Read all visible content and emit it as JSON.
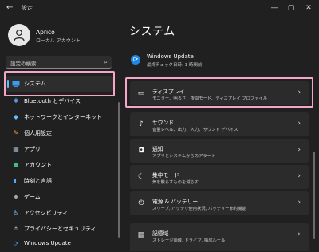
{
  "window": {
    "title": "設定",
    "back_icon": "arrow-left-icon",
    "minimize_glyph": "—",
    "maximize_glyph": "▢",
    "close_glyph": "✕"
  },
  "profile": {
    "name": "Aprico",
    "account_type": "ローカル アカウント"
  },
  "search": {
    "placeholder": "設定の検索"
  },
  "sidebar": {
    "items": [
      {
        "label": "システム",
        "icon": "monitor-icon",
        "active": true
      },
      {
        "label": "Bluetooth とデバイス",
        "icon": "bluetooth-icon"
      },
      {
        "label": "ネットワークとインターネット",
        "icon": "network-icon"
      },
      {
        "label": "個人用設定",
        "icon": "brush-icon"
      },
      {
        "label": "アプリ",
        "icon": "apps-icon"
      },
      {
        "label": "アカウント",
        "icon": "account-icon"
      },
      {
        "label": "時刻と言語",
        "icon": "globe-clock-icon"
      },
      {
        "label": "ゲーム",
        "icon": "gamepad-icon"
      },
      {
        "label": "アクセシビリティ",
        "icon": "accessibility-icon"
      },
      {
        "label": "プライバシーとセキュリティ",
        "icon": "shield-icon"
      },
      {
        "label": "Windows Update",
        "icon": "update-icon"
      }
    ]
  },
  "main": {
    "title": "システム",
    "windows_update": {
      "title": "Windows Update",
      "subtitle": "最終チェック日時: 1 時間前"
    },
    "cards": [
      {
        "title": "ディスプレイ",
        "subtitle": "モニター、明るさ、夜間モード、ディスプレイ プロファイル",
        "icon": "display-icon"
      },
      {
        "title": "サウンド",
        "subtitle": "音量レベル、出力、入力、サウンド デバイス",
        "icon": "speaker-icon"
      },
      {
        "title": "通知",
        "subtitle": "アプリとシステムからのアラート",
        "icon": "bell-icon"
      },
      {
        "title": "集中モード",
        "subtitle": "気を散らすものを減らす",
        "icon": "focus-icon"
      },
      {
        "title": "電源 & バッテリー",
        "subtitle": "スリープ, バッテリ使用状況, バッテリー節約機能",
        "icon": "power-icon"
      },
      {
        "title": "記憶域",
        "subtitle": "ストレージ領域, ドライブ, 構成ルール",
        "icon": "storage-icon"
      }
    ]
  },
  "colors": {
    "background": "#202020",
    "card": "#2b2b2b",
    "accent": "#4cc2ff",
    "highlight": "#f4a6c8"
  }
}
